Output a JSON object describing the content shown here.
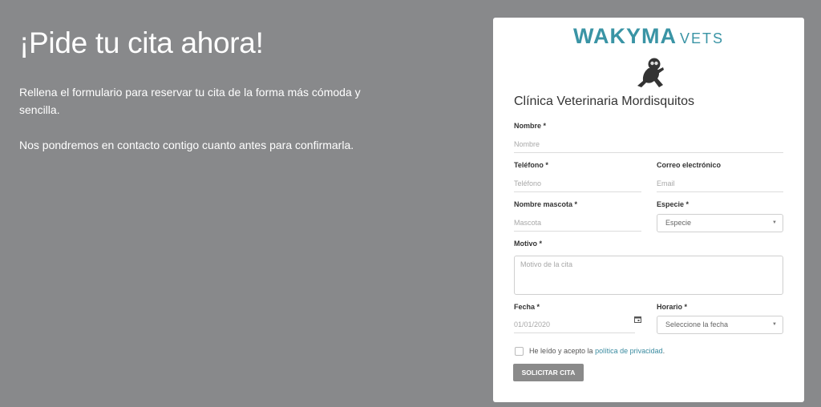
{
  "intro": {
    "title": "¡Pide tu cita ahora!",
    "paragraph1": "Rellena el formulario para reservar tu cita de la forma más cómoda y sencilla.",
    "paragraph2": "Nos pondremos en contacto contigo cuanto antes para confirmarla."
  },
  "card": {
    "logo_main": "WAKYMA",
    "logo_sub": "VETS",
    "clinic_name": "Clínica Veterinaria Mordisquitos"
  },
  "form": {
    "nombre": {
      "label": "Nombre *",
      "placeholder": "Nombre"
    },
    "telefono": {
      "label": "Teléfono *",
      "placeholder": "Teléfono"
    },
    "correo": {
      "label": "Correo electrónico",
      "placeholder": "Email"
    },
    "mascota": {
      "label": "Nombre mascota *",
      "placeholder": "Mascota"
    },
    "especie": {
      "label": "Especie *",
      "value": "Especie"
    },
    "motivo": {
      "label": "Motivo *",
      "placeholder": "Motivo de la cita"
    },
    "fecha": {
      "label": "Fecha *",
      "value": "01/01/2020"
    },
    "horario": {
      "label": "Horario *",
      "value": "Seleccione la fecha"
    },
    "terms_prefix": "He leído y acepto la ",
    "terms_link": "política de privacidad",
    "terms_suffix": ".",
    "submit_label": "SOLICITAR CITA"
  },
  "colors": {
    "accent": "#3a94a5",
    "page_bg": "#88898b",
    "button": "#8a8a8a"
  }
}
